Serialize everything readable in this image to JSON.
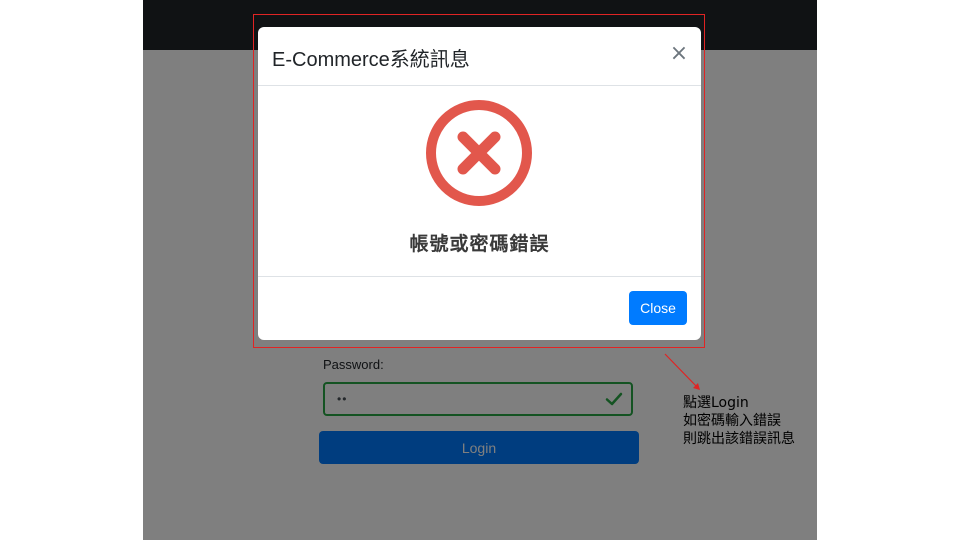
{
  "colors": {
    "navbar": "#212529",
    "backdrop": "rgba(0,0,0,0.5)",
    "primary": "#007bff",
    "valid": "#28a745",
    "error_icon": "#e2574c",
    "annotation": "#e02424"
  },
  "login_form": {
    "password_label": "Password:",
    "password_value": "••",
    "login_label": "Login",
    "valid_icon": "check-icon"
  },
  "modal": {
    "title": "E-Commerce系統訊息",
    "close_glyph": "×",
    "icon": "error-circle-icon",
    "message": "帳號或密碼錯誤",
    "close_button": "Close"
  },
  "annotation": {
    "lines": [
      "點選Login",
      "如密碼輸入錯誤",
      "則跳出該錯誤訊息"
    ]
  }
}
